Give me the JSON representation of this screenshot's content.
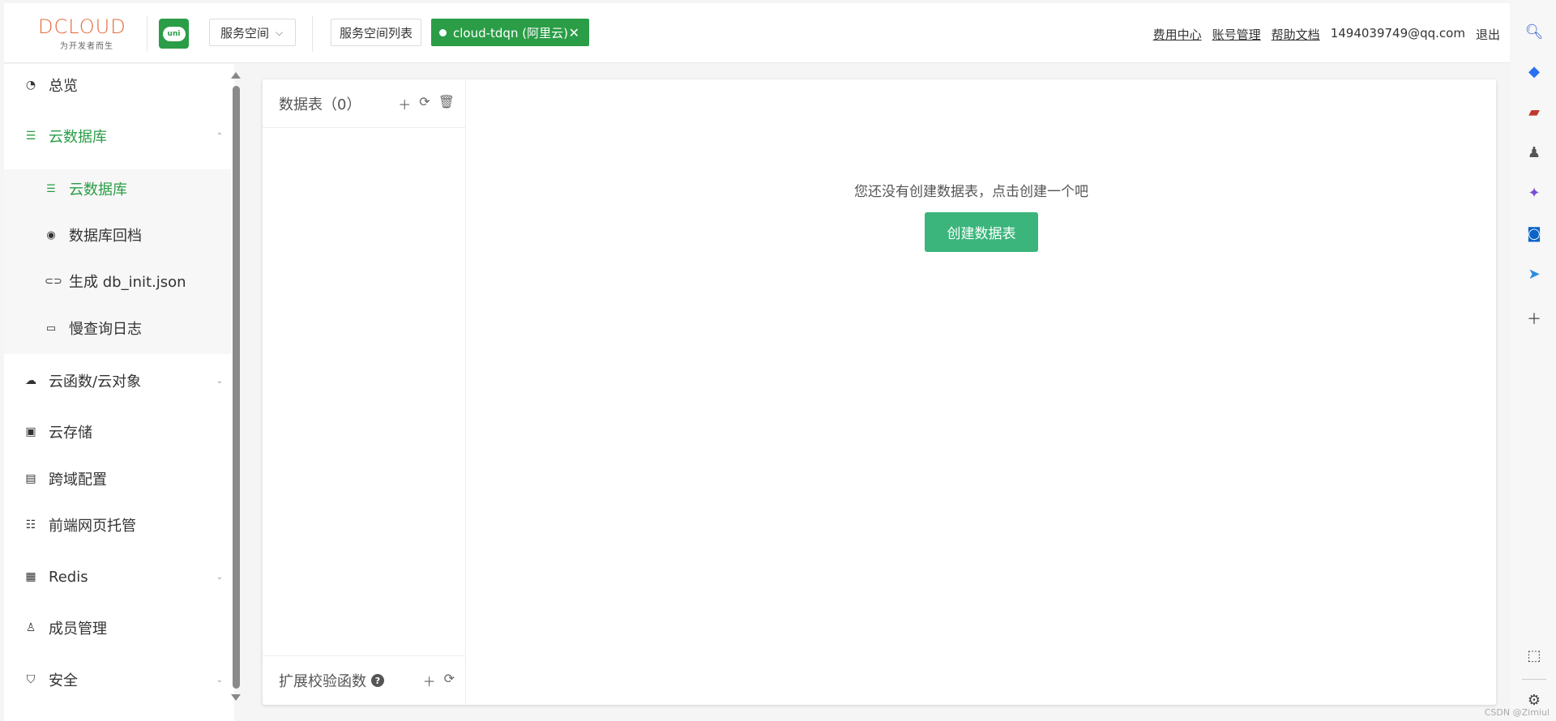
{
  "header": {
    "logo_text": "DCLOUD",
    "logo_tagline": "为开发者而生",
    "uni_logo_text": "uni",
    "space_selector": "服务空间",
    "space_list_button": "服务空间列表",
    "current_space": "cloud-tdqn (阿里云)",
    "links": {
      "billing": "费用中心",
      "account": "账号管理",
      "docs": "帮助文档",
      "email": "1494039749@qq.com",
      "logout": "退出"
    }
  },
  "sidebar": {
    "items": [
      {
        "label": "总览",
        "icon": "dashboard-icon"
      },
      {
        "label": "云数据库",
        "icon": "database-icon"
      },
      {
        "label": "云函数/云对象",
        "icon": "cloud-icon"
      },
      {
        "label": "云存储",
        "icon": "storage-icon"
      },
      {
        "label": "跨域配置",
        "icon": "cors-icon"
      },
      {
        "label": "前端网页托管",
        "icon": "hosting-icon"
      },
      {
        "label": "Redis",
        "icon": "redis-icon"
      },
      {
        "label": "成员管理",
        "icon": "member-icon"
      },
      {
        "label": "安全",
        "icon": "shield-icon"
      }
    ],
    "submenu": [
      {
        "label": "云数据库",
        "icon": "database-icon"
      },
      {
        "label": "数据库回档",
        "icon": "rollback-icon"
      },
      {
        "label": "生成 db_init.json",
        "icon": "link-icon"
      },
      {
        "label": "慢查询日志",
        "icon": "log-icon"
      }
    ]
  },
  "tables": {
    "header": "数据表（0）",
    "footer": "扩展校验函数",
    "help": "?"
  },
  "main": {
    "empty_message": "您还没有创建数据表，点击创建一个吧",
    "create_button": "创建数据表"
  },
  "watermark": "CSDN @Zimiul",
  "colors": {
    "accent": "#2a9d46",
    "button": "#3bb57b"
  }
}
